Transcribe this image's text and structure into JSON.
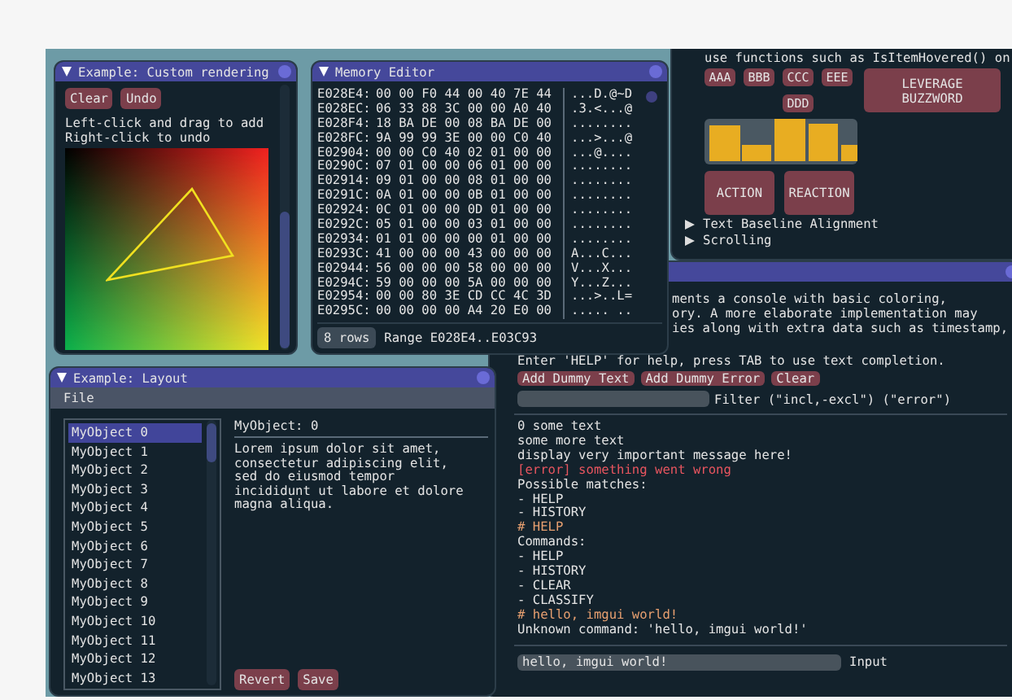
{
  "custom_rendering": {
    "title": "Example: Custom rendering",
    "buttons": [
      "Clear",
      "Undo"
    ],
    "help": [
      "Left-click and drag to add",
      "Right-click to undo"
    ]
  },
  "memory_editor": {
    "title": "Memory Editor",
    "rows": [
      {
        "address": "E028E4:",
        "bytes": "00 00 F0 44 00 40 7E 44",
        "ascii": "...D.@~D"
      },
      {
        "address": "E028EC:",
        "bytes": "06 33 88 3C 00 00 A0 40",
        "ascii": ".3.<...@"
      },
      {
        "address": "E028F4:",
        "bytes": "18 BA DE 00 08 BA DE 00",
        "ascii": "........"
      },
      {
        "address": "E028FC:",
        "bytes": "9A 99 99 3E 00 00 C0 40",
        "ascii": "...>...@"
      },
      {
        "address": "E02904:",
        "bytes": "00 00 C0 40 02 01 00 00",
        "ascii": "...@...."
      },
      {
        "address": "E0290C:",
        "bytes": "07 01 00 00 06 01 00 00",
        "ascii": "........"
      },
      {
        "address": "E02914:",
        "bytes": "09 01 00 00 08 01 00 00",
        "ascii": "........"
      },
      {
        "address": "E0291C:",
        "bytes": "0A 01 00 00 0B 01 00 00",
        "ascii": "........"
      },
      {
        "address": "E02924:",
        "bytes": "0C 01 00 00 0D 01 00 00",
        "ascii": "........"
      },
      {
        "address": "E0292C:",
        "bytes": "05 01 00 00 03 01 00 00",
        "ascii": "........"
      },
      {
        "address": "E02934:",
        "bytes": "01 01 00 00 00 01 00 00",
        "ascii": "........"
      },
      {
        "address": "E0293C:",
        "bytes": "41 00 00 00 43 00 00 00",
        "ascii": "A...C..."
      },
      {
        "address": "E02944:",
        "bytes": "56 00 00 00 58 00 00 00",
        "ascii": "V...X..."
      },
      {
        "address": "E0294C:",
        "bytes": "59 00 00 00 5A 00 00 00",
        "ascii": "Y...Z..."
      },
      {
        "address": "E02954:",
        "bytes": "00 00 80 3E CD CC 4C 3D",
        "ascii": "...>..L="
      },
      {
        "address": "E0295C:",
        "bytes": "00 00 00 00 A4 20 E0 00",
        "ascii": "..... .."
      }
    ],
    "rows_button": "8 rows",
    "range": "Range E028E4..E03C93"
  },
  "demo_panel": {
    "text": "use functions such as IsItemHovered() on",
    "small_buttons": [
      "AAA",
      "BBB",
      "CCC",
      "EEE",
      "DDD"
    ],
    "wide_button": "LEVERAGE BUZZWORD",
    "big_buttons": [
      "ACTION",
      "REACTION"
    ],
    "tree_nodes": [
      {
        "label": "Text Baseline Alignment",
        "expanded": false
      },
      {
        "label": "Scrolling",
        "expanded": false
      }
    ]
  },
  "console": {
    "description": [
      "ments a console with basic coloring,",
      "ory. A more elaborate implementation may",
      "ies along with extra data such as timestamp,"
    ],
    "hint": "Enter 'HELP' for help, press TAB to use text completion.",
    "buttons": [
      "Add Dummy Text",
      "Add Dummy Error",
      "Clear"
    ],
    "filter_label": "Filter (\"incl,-excl\") (\"error\")",
    "log": [
      {
        "text": "0 some text",
        "kind": "normal"
      },
      {
        "text": "some more text",
        "kind": "normal"
      },
      {
        "text": "display very important message here!",
        "kind": "normal"
      },
      {
        "text": "[error] something went wrong",
        "kind": "error"
      },
      {
        "text": "Possible matches:",
        "kind": "normal"
      },
      {
        "text": "- HELP",
        "kind": "normal"
      },
      {
        "text": "- HISTORY",
        "kind": "normal"
      },
      {
        "text": "# HELP",
        "kind": "command"
      },
      {
        "text": "Commands:",
        "kind": "normal"
      },
      {
        "text": "- HELP",
        "kind": "normal"
      },
      {
        "text": "- HISTORY",
        "kind": "normal"
      },
      {
        "text": "- CLEAR",
        "kind": "normal"
      },
      {
        "text": "- CLASSIFY",
        "kind": "normal"
      },
      {
        "text": "# hello, imgui world!",
        "kind": "command"
      },
      {
        "text": "Unknown command: 'hello, imgui world!'",
        "kind": "normal"
      }
    ],
    "input": "hello, imgui world!",
    "input_label": "Input"
  },
  "layout": {
    "title": "Example: Layout",
    "menu": [
      "File"
    ],
    "items": [
      {
        "label": "MyObject 0",
        "selected": true
      },
      {
        "label": "MyObject 1",
        "selected": false
      },
      {
        "label": "MyObject 2",
        "selected": false
      },
      {
        "label": "MyObject 3",
        "selected": false
      },
      {
        "label": "MyObject 4",
        "selected": false
      },
      {
        "label": "MyObject 5",
        "selected": false
      },
      {
        "label": "MyObject 6",
        "selected": false
      },
      {
        "label": "MyObject 7",
        "selected": false
      },
      {
        "label": "MyObject 8",
        "selected": false
      },
      {
        "label": "MyObject 9",
        "selected": false
      },
      {
        "label": "MyObject 10",
        "selected": false
      },
      {
        "label": "MyObject 11",
        "selected": false
      },
      {
        "label": "MyObject 12",
        "selected": false
      },
      {
        "label": "MyObject 13",
        "selected": false
      }
    ],
    "detail_title": "MyObject: 0",
    "detail_text": "Lorem ipsum dolor sit amet, consectetur adipiscing elit, sed do eiusmod tempor incididunt ut labore et dolore magna aliqua.",
    "buttons": [
      "Revert",
      "Save"
    ]
  }
}
